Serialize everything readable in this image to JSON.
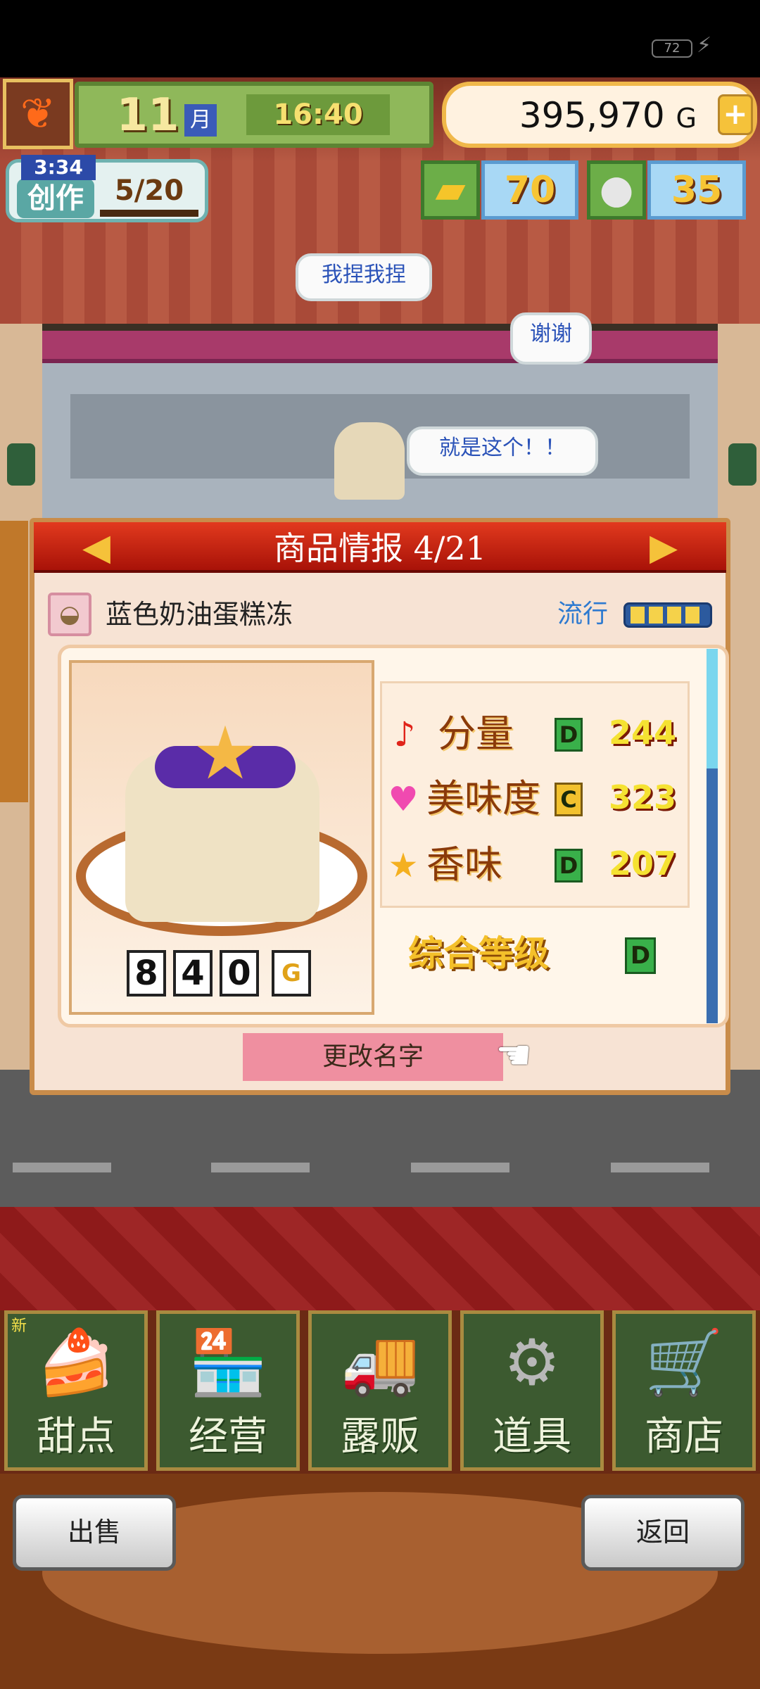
{
  "status_bar": {
    "battery": "72",
    "charging_icon": "bolt-icon"
  },
  "hud": {
    "month_number": "11",
    "month_unit": "月",
    "time": "16:40",
    "money": "395,970",
    "currency": "G",
    "plus_label": "+",
    "craft": {
      "timer": "3:34",
      "label": "创作",
      "count": "5/20"
    },
    "gold_bars": "70",
    "medals": "35"
  },
  "speech": [
    "我捏我捏",
    "谢谢",
    "就是这个！！"
  ],
  "panel": {
    "title": "商品情报 4/21",
    "prev_arrow": "◀",
    "next_arrow": "▶",
    "item_name": "蓝色奶油蛋糕冻",
    "trend_label": "流行",
    "trend_level": 4,
    "price_digits": [
      "8",
      "4",
      "0"
    ],
    "price_unit": "G",
    "stats": [
      {
        "icon": "music-note-icon",
        "glyph": "♪",
        "label": "分量",
        "grade": "D",
        "value": "244"
      },
      {
        "icon": "heart-icon",
        "glyph": "♥",
        "label": "美味度",
        "grade": "C",
        "value": "323"
      },
      {
        "icon": "star-icon",
        "glyph": "★",
        "label": "香味",
        "grade": "D",
        "value": "207"
      }
    ],
    "overall_label": "综合等级",
    "overall_grade": "D",
    "rename_label": "更改名字"
  },
  "menu": {
    "new_badge": "新",
    "items": [
      {
        "label": "甜点",
        "icon": "cake-icon",
        "glyph": "🍰"
      },
      {
        "label": "经营",
        "icon": "shop-icon",
        "glyph": "🏪"
      },
      {
        "label": "露贩",
        "icon": "food-truck-icon",
        "glyph": "🚚"
      },
      {
        "label": "道具",
        "icon": "gear-bag-icon",
        "glyph": "⚙"
      },
      {
        "label": "商店",
        "icon": "cart-icon",
        "glyph": "🛒"
      }
    ]
  },
  "bottom": {
    "sell_label": "出售",
    "back_label": "返回"
  }
}
